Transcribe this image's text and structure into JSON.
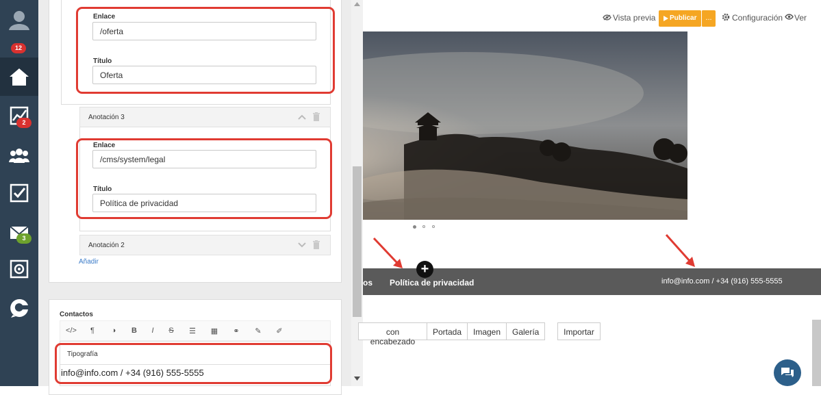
{
  "sidebar": {
    "avatar_badge": "12",
    "analytics_badge": "2",
    "mail_badge": "3"
  },
  "editor": {
    "annotation_top": {
      "link_label": "Enlace",
      "link_value": "/oferta",
      "title_label": "Título",
      "title_value": "Oferta"
    },
    "annotation3": {
      "header": "Anotación 3",
      "link_label": "Enlace",
      "link_value": "/cms/system/legal",
      "title_label": "Título",
      "title_value": "Política de privacidad"
    },
    "annotation2": {
      "header": "Anotación 2"
    },
    "add_link": "Añadir",
    "contacts": {
      "label": "Contactos",
      "toolbar": [
        "</>",
        "¶",
        "◑",
        "B",
        "I",
        "S",
        "☰",
        "▦",
        "⚭",
        "✎",
        "✐"
      ],
      "typography_label": "Tipografía",
      "content": "info@info.com / +34 (916) 555-5555"
    }
  },
  "preview": {
    "top_bar": {
      "preview_label": "Vista previa",
      "publish_label": "Publicar",
      "more_label": "...",
      "settings_label": "Configuración",
      "view_label": "Ver"
    },
    "footer": {
      "partial_link": "os",
      "privacy_link": "Política de privacidad",
      "contact_text": "info@info.com / +34 (916) 555-5555"
    },
    "tabs": [
      "con encabezado",
      "Portada",
      "Imagen",
      "Galería"
    ],
    "import_label": "Importar"
  },
  "colors": {
    "accent_orange": "#f5a623",
    "highlight_red": "#e03b32",
    "rail_bg": "#2f4254"
  }
}
